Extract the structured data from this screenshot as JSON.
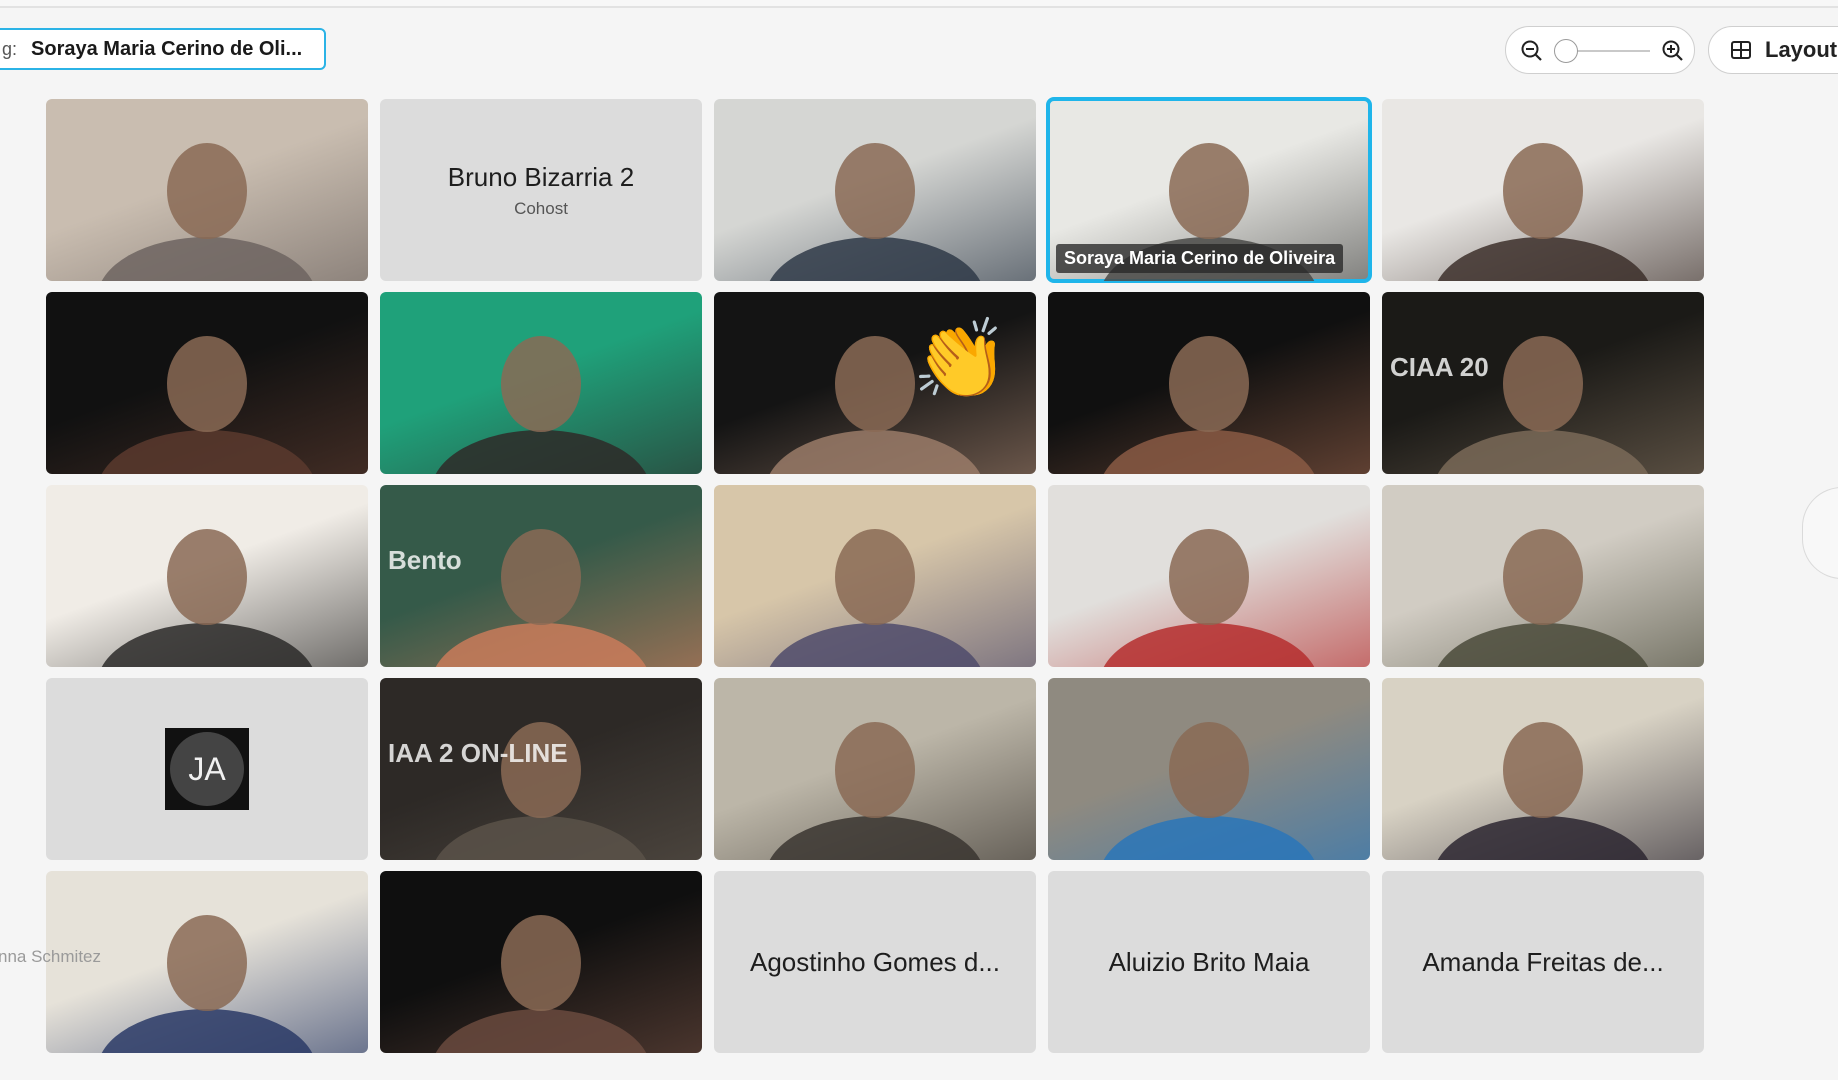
{
  "header": {
    "speaking_prefix": "g:",
    "speaking_name": "Soraya Maria Cerino de Oli...",
    "layout_label": "Layout",
    "zoom_level": 0.0
  },
  "tiles": [
    {
      "type": "video",
      "tone": [
        "#c9bdb0",
        "#6d6460"
      ]
    },
    {
      "type": "name",
      "name": "Bruno Bizarria 2",
      "role": "Cohost"
    },
    {
      "type": "video",
      "tone": [
        "#d5d6d3",
        "#2f3a48"
      ]
    },
    {
      "type": "video",
      "tone": [
        "#e8e8e4",
        "#4a4a48"
      ],
      "active": true,
      "label": "Soraya Maria Cerino de Oliveira"
    },
    {
      "type": "video",
      "tone": [
        "#e9e7e4",
        "#3c2f2a"
      ]
    },
    {
      "type": "video",
      "tone": [
        "#111111",
        "#5a3a2e"
      ]
    },
    {
      "type": "video",
      "tone": [
        "#1fa17a",
        "#2e2a28"
      ]
    },
    {
      "type": "video",
      "tone": [
        "#141414",
        "#9a7b68"
      ],
      "emoji": "👏"
    },
    {
      "type": "video",
      "tone": [
        "#101010",
        "#8a5a44"
      ]
    },
    {
      "type": "video",
      "tone": [
        "#1b1a17",
        "#7a6a58"
      ],
      "bg_text": "CIAA 20"
    },
    {
      "type": "video",
      "tone": [
        "#f0ece6",
        "#2b2a29"
      ]
    },
    {
      "type": "video",
      "tone": [
        "#355a49",
        "#c97b5b"
      ],
      "bg_text": "Bento"
    },
    {
      "type": "video",
      "tone": [
        "#d7c6a9",
        "#4f4b6b"
      ]
    },
    {
      "type": "video",
      "tone": [
        "#e1dfdc",
        "#b52e2e"
      ]
    },
    {
      "type": "video",
      "tone": [
        "#d1ccc3",
        "#4a4a3a"
      ]
    },
    {
      "type": "avatar",
      "initials": "JA"
    },
    {
      "type": "video",
      "tone": [
        "#2d2926",
        "#5a5249"
      ],
      "bg_text": "IAA 2  ON-LINE"
    },
    {
      "type": "video",
      "tone": [
        "#bcb6a8",
        "#3a3530"
      ]
    },
    {
      "type": "video",
      "tone": [
        "#8f8a80",
        "#2a76b8"
      ]
    },
    {
      "type": "video",
      "tone": [
        "#d8d2c4",
        "#2b2630"
      ]
    },
    {
      "type": "video",
      "tone": [
        "#e6e2d9",
        "#2a3a66"
      ]
    },
    {
      "type": "video",
      "tone": [
        "#0f0f0f",
        "#6a4a3e"
      ]
    },
    {
      "type": "name",
      "name": "Agostinho Gomes d..."
    },
    {
      "type": "name",
      "name": "Aluizio Brito Maia"
    },
    {
      "type": "name",
      "name": "Amanda Freitas de..."
    }
  ],
  "edge_participant": "nna Schmitez"
}
